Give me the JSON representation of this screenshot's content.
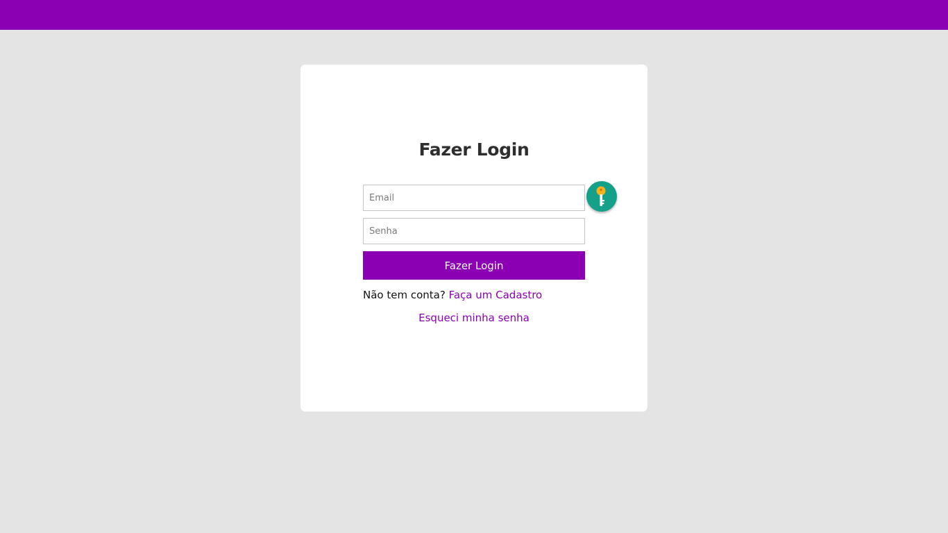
{
  "colors": {
    "brand": "#8a00b2",
    "page_background": "#e4e4e4",
    "card_background": "#ffffff",
    "key_badge": "#14a089",
    "key_icon": "#f5b21d"
  },
  "login": {
    "title": "Fazer Login",
    "email_placeholder": "Email",
    "email_value": "",
    "password_placeholder": "Senha",
    "password_value": "",
    "submit_label": "Fazer Login",
    "signup_prompt": "Não tem conta?",
    "signup_link": "Faça um Cadastro",
    "forgot_link": "Esqueci minha senha"
  },
  "icons": {
    "password_manager": "key-icon"
  }
}
